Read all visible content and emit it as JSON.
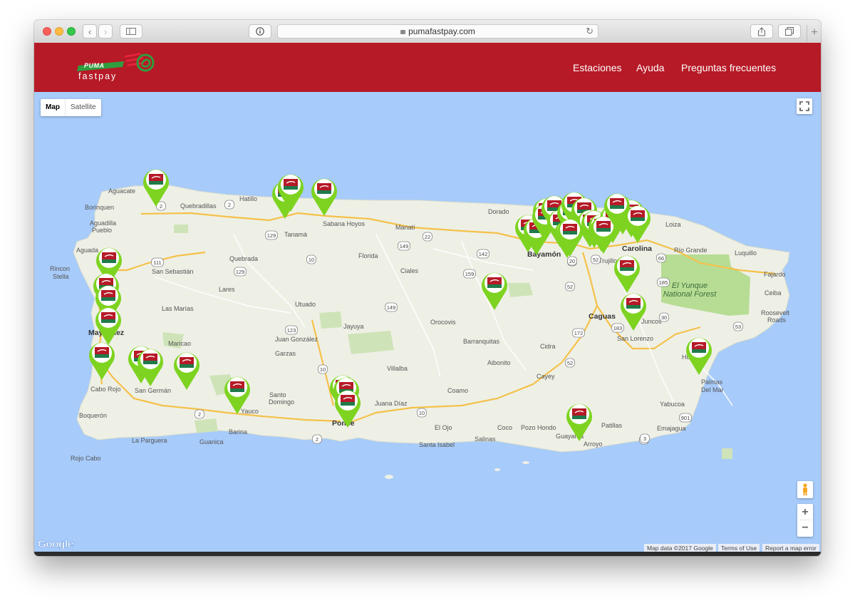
{
  "browser": {
    "url": "pumafastpay.com"
  },
  "brand": {
    "logo_word_top": "PUMA",
    "logo_word_bottom": "fastpay",
    "color": "#b61a27",
    "accent_green": "#3da33a"
  },
  "nav": {
    "items": [
      "Estaciones",
      "Ayuda",
      "Preguntas frecuentes"
    ]
  },
  "map": {
    "type_controls": {
      "map": "Map",
      "satellite": "Satellite"
    },
    "zoom_in": "+",
    "zoom_out": "−",
    "google_logo": "Google",
    "attribution": "Map data ©2017 Google",
    "terms": "Terms of Use",
    "report": "Report a map error",
    "place_labels": [
      "Aguacate",
      "Borinquen",
      "Aguadilla Pueblo",
      "Aguada",
      "Rincon Stella",
      "Quebradillas",
      "Hatillo",
      "Tanamá",
      "Sabana Hoyos",
      "Manatí",
      "Dorado",
      "Bayamón",
      "Carolina",
      "Loiza",
      "Río Grande",
      "Luquillo",
      "Fajardo",
      "Ceiba",
      "Roosevelt Roads",
      "El Yunque National Forest",
      "Trujillo Alto",
      "Caguas",
      "Juncos",
      "San Lorenzo",
      "Humacao",
      "Palmas Del Mar",
      "Yabucoa",
      "Emajagua",
      "Patillas",
      "Arroyo",
      "Guayama",
      "Pozo Hondo",
      "Coco",
      "Salinas",
      "Santa Isabel",
      "El Ojo",
      "Juana Díaz",
      "Ponce",
      "Coamo",
      "Villalba",
      "Aibonito",
      "Cayey",
      "Cidra",
      "Barranquitas",
      "Orocovis",
      "Jayuya",
      "Ciales",
      "Florida",
      "Utuado",
      "Quebrada",
      "Lares",
      "San Sebastián",
      "Las Marías",
      "Maricao",
      "Mayagüez",
      "Cabo Rojo",
      "San Germán",
      "Yauco",
      "Santo Domingo",
      "Barina",
      "Guanica",
      "La Parguera",
      "Boquerón",
      "Rojo Cabo",
      "Juan González",
      "Garzas",
      "Mayaguez"
    ],
    "road_shields": [
      "2",
      "2",
      "129",
      "129",
      "10",
      "111",
      "2",
      "22",
      "149",
      "142",
      "159",
      "149",
      "123",
      "10",
      "52",
      "52",
      "172",
      "52",
      "901",
      "3",
      "185",
      "3",
      "66",
      "30",
      "53",
      "183",
      "20",
      "20",
      "2",
      "2",
      "10"
    ],
    "station_count": 42,
    "marker_color": "#7ed321"
  }
}
